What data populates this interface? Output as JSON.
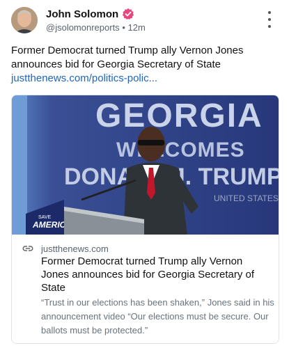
{
  "post": {
    "author_name": "John Solomon",
    "handle": "@jsolomonreports",
    "separator": "•",
    "time": "12m",
    "text": "Former Democrat turned Trump ally Vernon Jones announces bid for Georgia Secretary of State",
    "link_text": "justthenews.com/politics-polic..."
  },
  "card": {
    "image_sign_lines": [
      "GEORGIA",
      "WELCOMES",
      "DONALD J. TRUMP",
      "UNITED STATES"
    ],
    "podium_text": [
      "SAVE",
      "AMERICA"
    ],
    "domain": "justthenews.com",
    "title": "Former Democrat turned Trump ally Vernon Jones announces bid for Georgia Secretary of State",
    "description": "“Trust in our elections has been shaken,” Jones said in his announcement video “Our elections must be secure. Our ballots must be protected.”"
  },
  "icons": {
    "verified": "verified-badge-icon",
    "more": "more-vertical-icon",
    "link": "link-icon"
  },
  "colors": {
    "link": "#1d65c1",
    "verified": "#e8467c",
    "secondary_text": "#59636e",
    "banner_blue": "#2e3f86"
  }
}
